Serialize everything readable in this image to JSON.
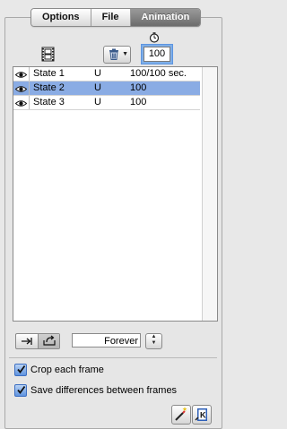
{
  "tabs": [
    {
      "label": "Options",
      "active": false
    },
    {
      "label": "File",
      "active": false
    },
    {
      "label": "Animation",
      "active": true
    }
  ],
  "toolbar": {
    "film_icon": "film-frames-icon",
    "delete_icon": "trash-icon",
    "clock_icon": "clock-icon",
    "frame_delay": "100"
  },
  "states": [
    {
      "name": "State 1",
      "flag": "U",
      "duration": "100/100 sec.",
      "visible": true,
      "selected": false
    },
    {
      "name": "State 2",
      "flag": "U",
      "duration": "100",
      "visible": true,
      "selected": true
    },
    {
      "name": "State 3",
      "flag": "U",
      "duration": "100",
      "visible": true,
      "selected": false
    }
  ],
  "playback": {
    "loop_value": "Forever"
  },
  "options": {
    "crop_label": "Crop each frame",
    "crop_checked": true,
    "save_diff_label": "Save differences between frames",
    "save_diff_checked": true
  },
  "colors": {
    "selection": "#8aace4",
    "active_tab": "#6c6c6c",
    "focus_ring": "#5d95e0"
  }
}
